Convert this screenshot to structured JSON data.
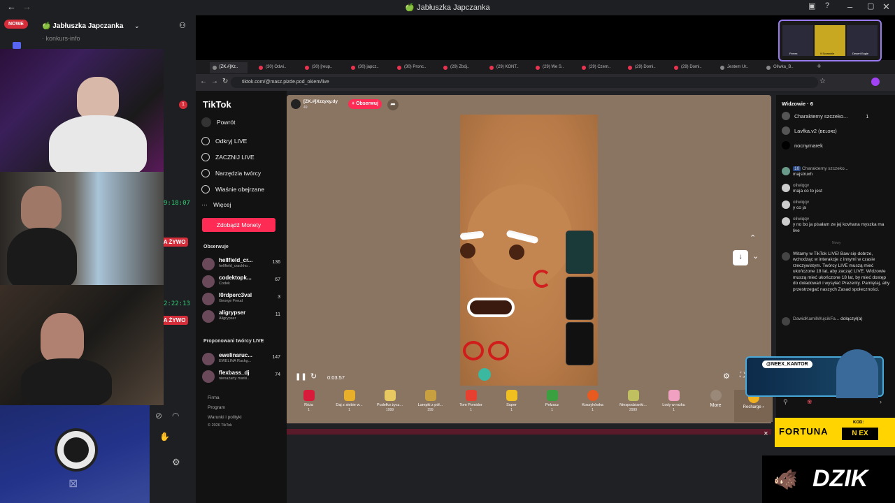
{
  "window": {
    "title": "🍏 Jabłuszka Japczanka"
  },
  "discord": {
    "new_badge": "NOWE",
    "server_name": "🍏 Jabłuszka Japczanka",
    "channel": "· konkurs-info",
    "notif_count": "1"
  },
  "cams": [
    {
      "timer": "",
      "live": ""
    },
    {
      "timer": "9:18:07",
      "live": "NA ŻYWO"
    },
    {
      "timer": "2:22:13",
      "live": "NA ŻYWO"
    }
  ],
  "browser": {
    "tabs": [
      {
        "label": "[ZK.#]Xz.."
      },
      {
        "label": "(30) Odwi.."
      },
      {
        "label": "(30) [reup.."
      },
      {
        "label": "(30) japcz.."
      },
      {
        "label": "(30) Pronc.."
      },
      {
        "label": "(29) Zbój.."
      },
      {
        "label": "(29) KONT.."
      },
      {
        "label": "(29) We S.."
      },
      {
        "label": "(29) Czem.."
      },
      {
        "label": "(29) Domi.."
      },
      {
        "label": "(29) Domi.."
      },
      {
        "label": "Jestem Ur.."
      },
      {
        "label": "Oliwka_B.."
      }
    ],
    "url": "tiktok.com/@masz.pizde.pod_okiem/live"
  },
  "tiktok": {
    "logo": "TikTok",
    "back": "Powrót",
    "nav": [
      {
        "label": "Odkryj LIVE",
        "icon": "live-icon"
      },
      {
        "label": "ZACZNIJ LIVE",
        "icon": "camera-icon"
      },
      {
        "label": "Narzędzia twórcy",
        "icon": "home-icon"
      },
      {
        "label": "Właśnie obejrzane",
        "icon": "history-icon"
      },
      {
        "label": "Więcej",
        "icon": "more-icon"
      }
    ],
    "coins_button": "Zdobądź Monety",
    "following_title": "Obserwuje",
    "following": [
      {
        "name": "hellfield_cr...",
        "sub": "hellfield_crackho..",
        "count": "136"
      },
      {
        "name": "codektopk...",
        "sub": "Codek",
        "count": "67"
      },
      {
        "name": "l0rdperc3val",
        "sub": "George Freud",
        "count": "3"
      },
      {
        "name": "aligrypser",
        "sub": "Aligrypser",
        "count": "11"
      }
    ],
    "suggested_title": "Proponowani twórcy LIVE",
    "suggested": [
      {
        "name": "ewelinaruc...",
        "sub": "EWELINA Ruckg...",
        "count": "147"
      },
      {
        "name": "flexbass_dj",
        "sub": "nienażarty marki..",
        "count": "74"
      }
    ],
    "footer": [
      "Firma",
      "Program",
      "Warunki i polityki",
      "© 2026 TikTok"
    ],
    "streamer": {
      "name": "[ZK.#]Xzzyxy.dy",
      "viewers": "49",
      "follow": "+ Obserwuj"
    },
    "elapsed": "0:03:57",
    "gifts": [
      {
        "name": "Róża",
        "price": "1",
        "color": "#d81b3a"
      },
      {
        "name": "Daj z siebie w...",
        "price": "1",
        "color": "#e8b02a"
      },
      {
        "name": "Pudełko życz...",
        "price": "1999",
        "color": "#e8c860"
      },
      {
        "name": "Lampki z pół...",
        "price": "299",
        "color": "#c8a040"
      },
      {
        "name": "Tom Pomidor",
        "price": "1",
        "color": "#e84030"
      },
      {
        "name": "Super",
        "price": "1",
        "color": "#f0c020"
      },
      {
        "name": "Pełzacz",
        "price": "1",
        "color": "#3aa040"
      },
      {
        "name": "Koszykówka",
        "price": "1",
        "color": "#e85a20"
      },
      {
        "name": "Niespodzianki...",
        "price": "2999",
        "color": "#c0c060"
      },
      {
        "name": "Lody w rożku",
        "price": "1",
        "color": "#f0a0c0"
      }
    ],
    "more": "More",
    "recharge": "Recharge ›",
    "viewers_title": "Widzowie · 6",
    "viewers_list": [
      {
        "name": "Charakterny szczeko...",
        "count": "1"
      },
      {
        "name": "Lavfka.v2 (ʙᴇʟᴏʀɪ)",
        "count": ""
      },
      {
        "name": "nocnymarek",
        "count": ""
      }
    ],
    "chat": [
      {
        "user": "Charakterny szczeko...",
        "text": "majstruxh",
        "badge": "10"
      },
      {
        "user": "oliwiqqv",
        "text": "maja co to jest"
      },
      {
        "user": "oliwiqqv",
        "text": "y co ja"
      },
      {
        "user": "oliwiqqv",
        "text": "y no bo ja pisałam ze jej kovhana myszka ma live"
      }
    ],
    "new_label": "Nowy",
    "system_msg": "Witamy w TikTok LIVE! Baw się dobrze, wchodząc w interakcje z innymi w czasie rzeczywistym. Twórcy LIVE muszą mieć ukończone 18 lat, aby zacząć LIVE. Widzowie muszą mieć ukończone 18 lat, by mieć dostęp do doładowań i wysyłać Prezenty. Pamiętaj, aby przestrzegać naszych Zasad społeczności.",
    "joined": {
      "user": "DawidKamilWujcikFa...",
      "text": "dołączył(a)"
    }
  },
  "overlay": {
    "instagram": "@NEEX_KANTOR",
    "fortuna": "FORTUNA",
    "kod_label": "KOD:",
    "kod": "N EX",
    "dzik": "DZIK",
    "mini_labels": [
      "Ferrex",
      "9 Scramble",
      "Desert Eagle"
    ]
  }
}
